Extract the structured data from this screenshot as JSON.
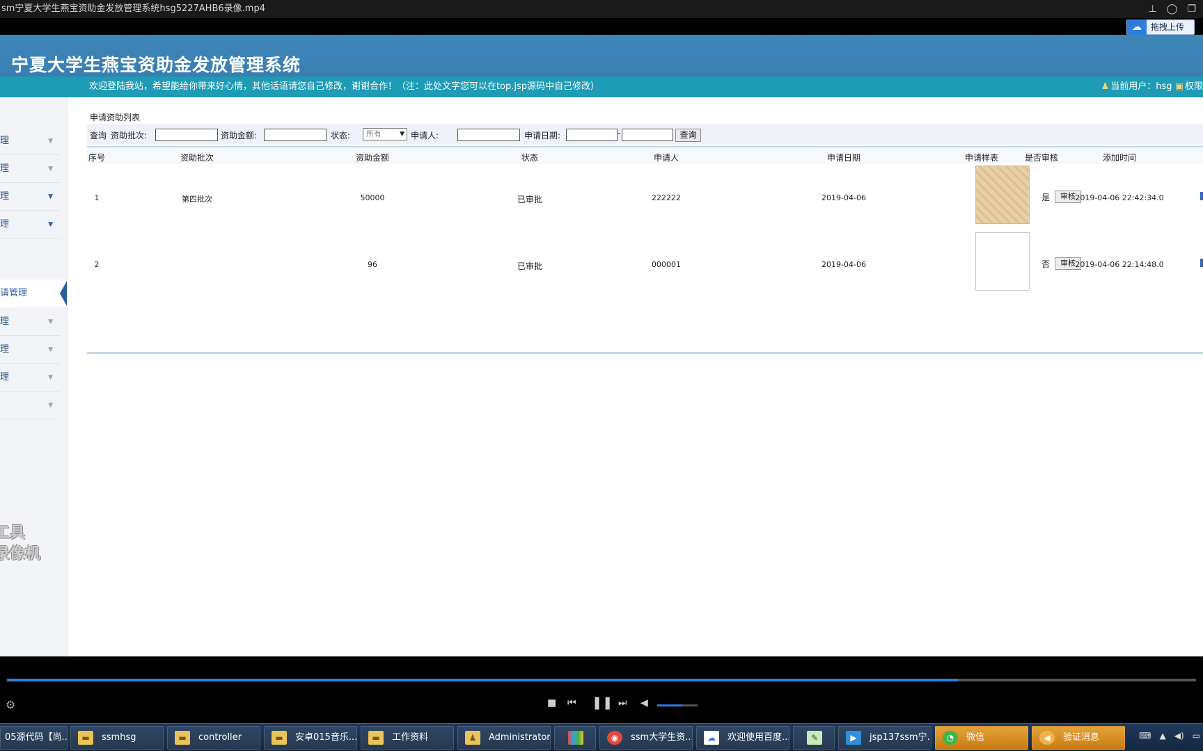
{
  "player": {
    "title": "sm宁夏大学生燕宝资助金发放管理系统hsg5227AHB6录像.mp4",
    "upload_label": "拖拽上传",
    "progress_fraction": 0.8,
    "volume_fraction": 0.62
  },
  "app": {
    "title": "宁夏大学生燕宝资助金发放管理系统",
    "welcome": "欢迎登陆我站，希望能给你带来好心情，其他话语请您自己修改，谢谢合作！（注：此处文字您可以在top.jsp源码中自己修改）",
    "user_info": "当前用户：hsg",
    "permission_label": "权限"
  },
  "sidebar": {
    "items": [
      {
        "label": "理"
      },
      {
        "label": "理"
      },
      {
        "label": "理"
      },
      {
        "label": "理"
      },
      {
        "label": "理"
      },
      {
        "label": "理"
      },
      {
        "label": "理"
      },
      {
        "label": ""
      }
    ],
    "active_sub": "请管理",
    "watermark_line1": "工具",
    "watermark_line2": "录像机"
  },
  "content": {
    "list_title": "申请资助列表",
    "search": {
      "query_label": "查询",
      "batch_label": "资助批次:",
      "amount_label": "资助金额:",
      "status_label": "状态:",
      "status_value": "所有",
      "applicant_label": "申请人:",
      "date_label": "申请日期:",
      "date_sep": "-",
      "button": "查询"
    },
    "columns": [
      "序号",
      "资助批次",
      "资助金额",
      "状态",
      "申请人",
      "申请日期",
      "申请样表",
      "是否审核",
      "添加时间"
    ],
    "rows": [
      {
        "index": "1",
        "batch": "第四批次",
        "amount": "50000",
        "status": "已审批",
        "applicant": "222222",
        "date": "2019-04-06",
        "has_form": true,
        "reviewed": "是",
        "review_btn": "审核",
        "added": "2019-04-06 22:42:34.0"
      },
      {
        "index": "2",
        "batch": "",
        "amount": "96",
        "status": "已审批",
        "applicant": "000001",
        "date": "2019-04-06",
        "has_form": false,
        "reviewed": "否",
        "review_btn": "审核",
        "added": "2019-04-06 22:14:48.0"
      }
    ]
  },
  "taskbar": {
    "items": [
      {
        "label": "05源代码【尚...",
        "icon": "folder-icon"
      },
      {
        "label": "ssmhsg",
        "icon": "folder-icon"
      },
      {
        "label": "controller",
        "icon": "folder-icon"
      },
      {
        "label": "安卓015音乐...",
        "icon": "folder-icon"
      },
      {
        "label": "工作资料",
        "icon": "folder-icon"
      },
      {
        "label": "Administrator",
        "icon": "user-folder-icon"
      },
      {
        "label": "",
        "icon": "app-icon"
      },
      {
        "label": "ssm大学生资...",
        "icon": "chrome-icon"
      },
      {
        "label": "欢迎使用百度...",
        "icon": "baidu-icon"
      },
      {
        "label": "",
        "icon": "editor-icon"
      },
      {
        "label": "jsp137ssm宁...",
        "icon": "video-icon"
      },
      {
        "label": "微信",
        "icon": "wechat-icon"
      },
      {
        "label": "验证消息",
        "icon": "speaker-icon"
      }
    ]
  }
}
